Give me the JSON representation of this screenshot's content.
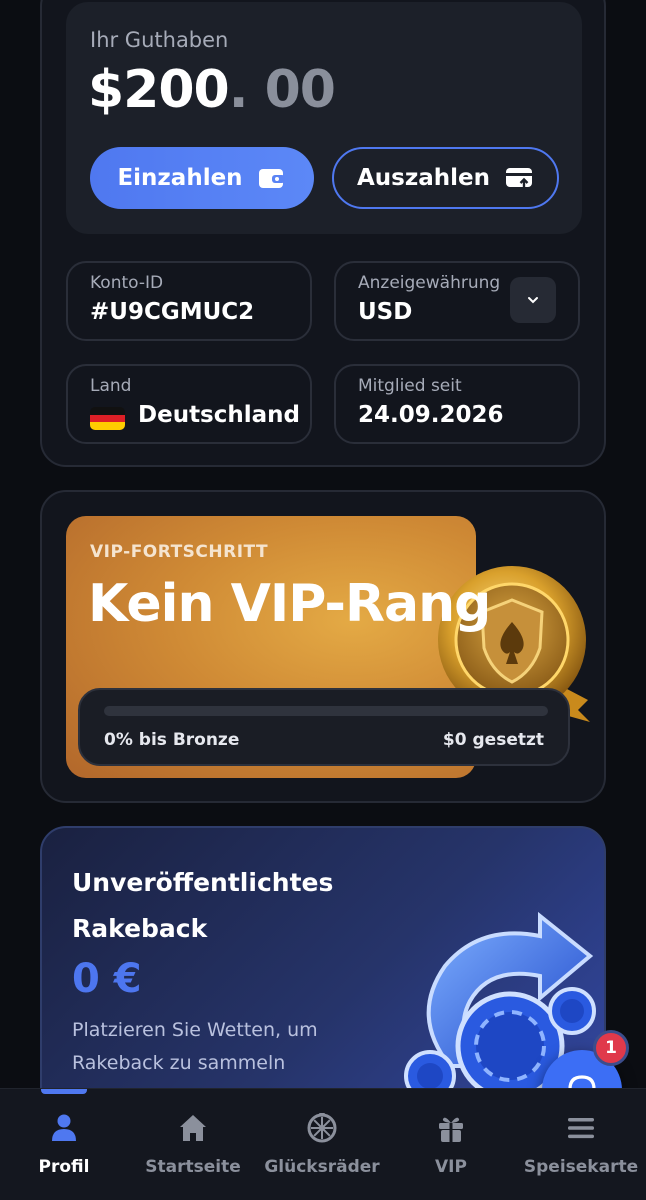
{
  "account": {
    "balance_label": "Ihr Guthaben",
    "balance_whole": "$200",
    "balance_decimal": ". 00",
    "deposit_label": "Einzahlen",
    "withdraw_label": "Auszahlen",
    "account_id_label": "Konto-ID",
    "account_id_value": "#U9CGMUC2",
    "currency_label": "Anzeigewährung",
    "currency_value": "USD",
    "country_label": "Land",
    "country_value": "Deutschland",
    "member_since_label": "Mitglied seit",
    "member_since_value": "24.09.2026"
  },
  "vip": {
    "overline": "VIP-FORTSCHRITT",
    "title": "Kein VIP-Rang",
    "progress_fraction": 0,
    "progress_text": "0% bis Bronze",
    "wagered_text": "$0 gesetzt"
  },
  "rakeback": {
    "title": "Unveröffentlichtes Rakeback",
    "amount": "0 €",
    "description": "Platzieren Sie Wetten, um Rakeback zu sammeln"
  },
  "support": {
    "badge_count": "1"
  },
  "nav": {
    "items": [
      {
        "label": "Profil",
        "icon": "user-icon"
      },
      {
        "label": "Startseite",
        "icon": "home-icon"
      },
      {
        "label": "Glücksräder",
        "icon": "wheel-icon"
      },
      {
        "label": "VIP",
        "icon": "gift-icon"
      },
      {
        "label": "Speisekarte",
        "icon": "menu-icon"
      }
    ],
    "active": "Profil"
  },
  "colors": {
    "accent": "#4f78f0",
    "vip_gold": "#cf8a35",
    "badge_red": "#e0394b"
  }
}
